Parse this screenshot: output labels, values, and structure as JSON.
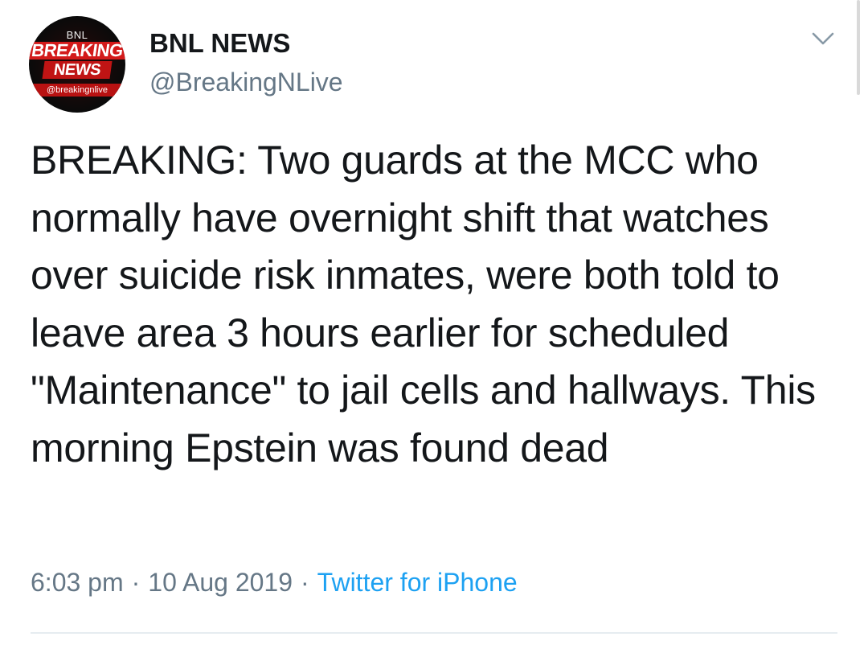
{
  "author": {
    "display_name": "BNL NEWS",
    "username": "@BreakingNLive",
    "avatar": {
      "top_text": "BNL",
      "line1": "BREAKING",
      "line2": "NEWS",
      "handle": "@breakingnlive",
      "accent_color": "#d31a1a"
    }
  },
  "tweet": {
    "text": "BREAKING: Two guards at the MCC who normally have overnight shift that watches over suicide risk inmates, were both told to leave area 3 hours earlier for scheduled \"Maintenance\" to jail cells and hallways. This morning Epstein was found dead"
  },
  "meta": {
    "time": "6:03 pm",
    "date": "10 Aug 2019",
    "separator": "·",
    "source": "Twitter for iPhone",
    "source_color": "#1da1f2"
  },
  "icons": {
    "menu": "chevron-down-icon"
  }
}
